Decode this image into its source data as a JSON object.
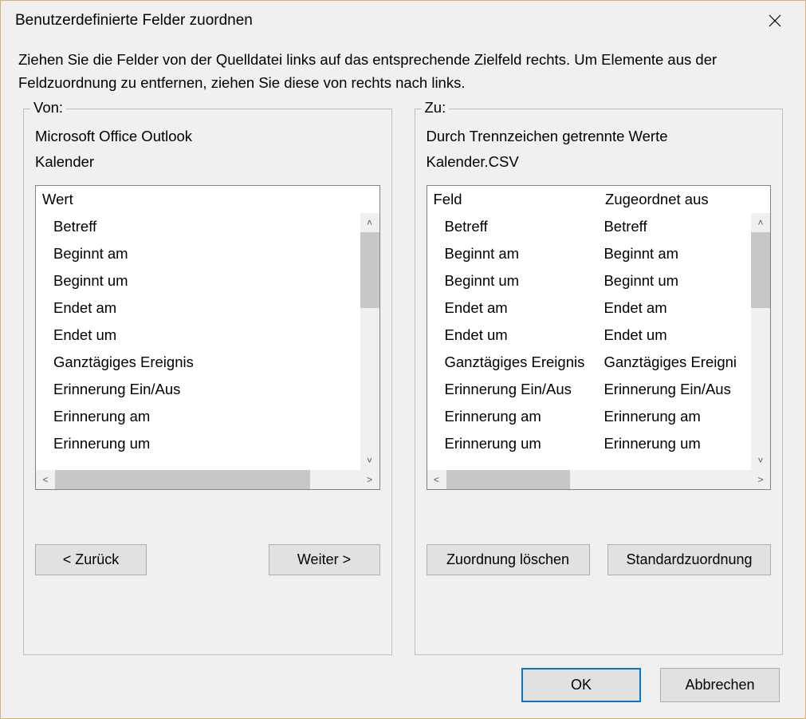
{
  "dialog": {
    "title": "Benutzerdefinierte Felder zuordnen",
    "instructions": "Ziehen Sie die Felder von der Quelldatei links auf das entsprechende Zielfeld rechts. Um Elemente aus der Feldzuordnung zu entfernen, ziehen Sie diese von rechts nach links."
  },
  "source": {
    "label": "Von:",
    "line1": "Microsoft Office Outlook",
    "line2": "Kalender",
    "header": "Wert",
    "items": [
      "Betreff",
      "Beginnt am",
      "Beginnt um",
      "Endet am",
      "Endet um",
      "Ganztägiges Ereignis",
      "Erinnerung Ein/Aus",
      "Erinnerung am",
      "Erinnerung um"
    ]
  },
  "target": {
    "label": "Zu:",
    "line1": "Durch Trennzeichen getrennte Werte",
    "line2": "Kalender.CSV",
    "header_field": "Feld",
    "header_mapped": "Zugeordnet aus",
    "items": [
      {
        "field": "Betreff",
        "mapped": "Betreff"
      },
      {
        "field": "Beginnt am",
        "mapped": "Beginnt am"
      },
      {
        "field": "Beginnt um",
        "mapped": "Beginnt um"
      },
      {
        "field": "Endet am",
        "mapped": "Endet am"
      },
      {
        "field": "Endet um",
        "mapped": "Endet um"
      },
      {
        "field": "Ganztägiges Ereignis",
        "mapped": "Ganztägiges Ereigni"
      },
      {
        "field": "Erinnerung Ein/Aus",
        "mapped": "Erinnerung Ein/Aus"
      },
      {
        "field": "Erinnerung am",
        "mapped": "Erinnerung am"
      },
      {
        "field": "Erinnerung um",
        "mapped": "Erinnerung um"
      }
    ]
  },
  "buttons": {
    "back": "< Zurück",
    "next": "Weiter >",
    "clear": "Zuordnung löschen",
    "default": "Standardzuordnung",
    "ok": "OK",
    "cancel": "Abbrechen"
  }
}
